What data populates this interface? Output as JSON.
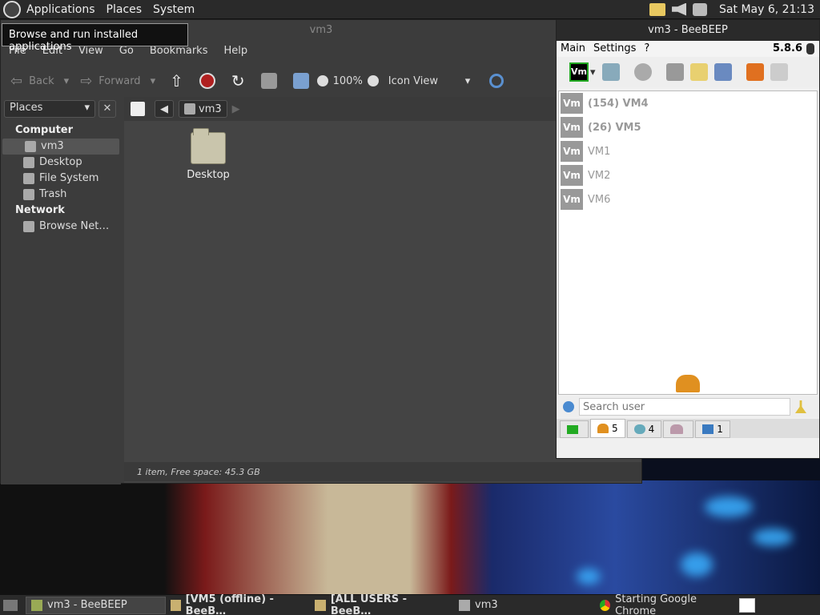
{
  "panel": {
    "menus": [
      "Applications",
      "Places",
      "System"
    ],
    "clock": "Sat May  6, 21:13"
  },
  "tooltip": "Browse and run installed applications",
  "nautilus": {
    "title": "vm3",
    "menus": [
      "File",
      "Edit",
      "View",
      "Go",
      "Bookmarks",
      "Help"
    ],
    "toolbar": {
      "back": "Back",
      "forward": "Forward",
      "zoom": "100%",
      "view": "Icon View"
    },
    "sidebar": {
      "dropdown": "Places",
      "close": "✕",
      "computer_label": "Computer",
      "computer_items": [
        "vm3",
        "Desktop",
        "File System",
        "Trash"
      ],
      "network_label": "Network",
      "network_items": [
        "Browse Net…"
      ]
    },
    "path": "vm3",
    "folder": {
      "label": "Desktop"
    },
    "status": "1 item, Free space: 45.3 GB"
  },
  "beebeep": {
    "title": "vm3 - BeeBEEP",
    "menus": [
      "Main",
      "Settings",
      "?"
    ],
    "version": "5.8.6",
    "vm_badge": "Vm",
    "users": [
      {
        "badge": "Vm",
        "name": "(154) VM4",
        "bold": true
      },
      {
        "badge": "Vm",
        "name": "(26) VM5",
        "bold": true
      },
      {
        "badge": "Vm",
        "name": "VM1",
        "bold": false
      },
      {
        "badge": "Vm",
        "name": "VM2",
        "bold": false
      },
      {
        "badge": "Vm",
        "name": "VM6",
        "bold": false
      }
    ],
    "search_placeholder": "Search user",
    "tabs": [
      "",
      "5",
      "4",
      "",
      "1"
    ]
  },
  "taskbar": [
    "vm3 - BeeBEEP",
    "[VM5 (offline) - BeeB…",
    "[ALL USERS - BeeB…",
    "vm3",
    "Starting Google Chrome"
  ],
  "colors": {
    "panel": "#2a2a2a",
    "window": "#3c3c3c",
    "bee_bg": "#f0f0f0",
    "vm_badge": "#999999"
  }
}
